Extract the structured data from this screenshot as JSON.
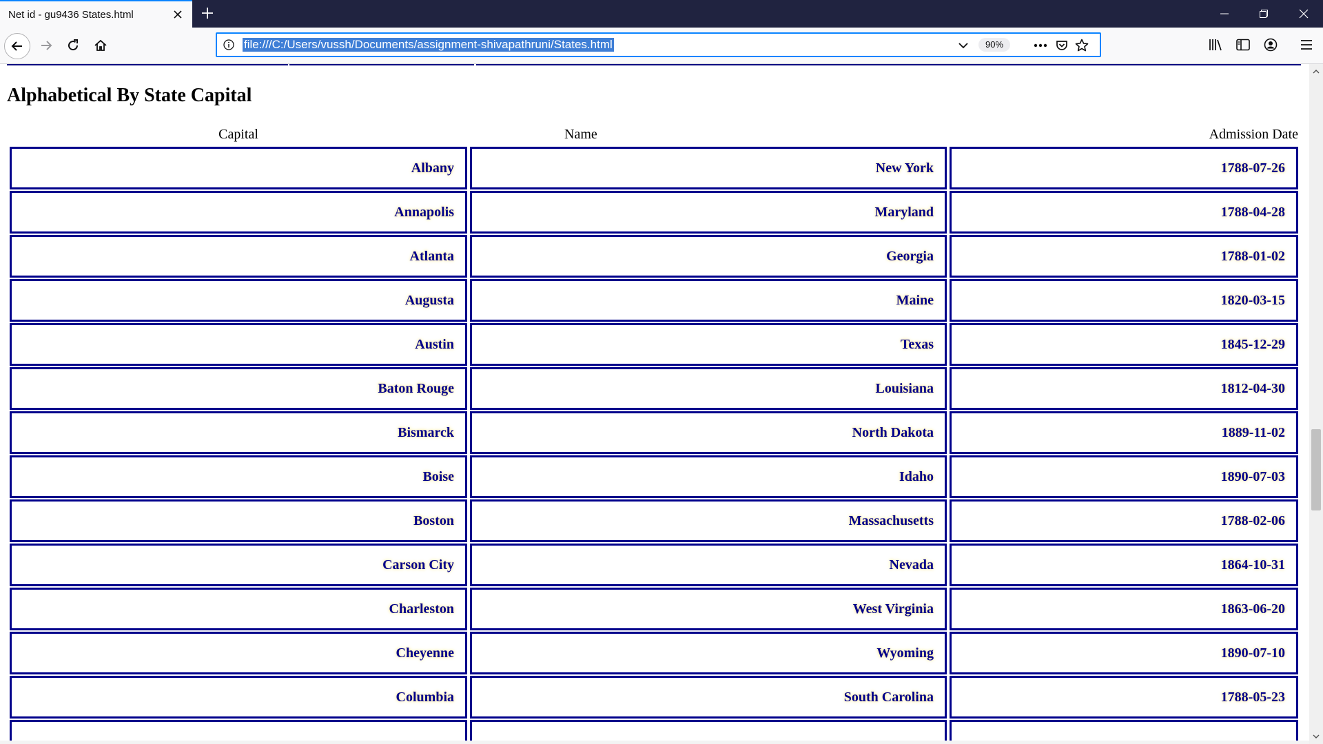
{
  "browser": {
    "tab_title": "Net id - gu9436 States.html",
    "url": "file:///C:/Users/vussh/Documents/assignment-shivapathruni/States.html",
    "zoom": "90%",
    "accent_color": "#0a84ff",
    "titlebar_color": "#202340"
  },
  "page": {
    "section_title": "Alphabetical By State Capital",
    "columns": {
      "capital": "Capital",
      "name": "Name",
      "admission_date": "Admission Date"
    },
    "rows": [
      {
        "capital": "Albany",
        "name": "New York",
        "date": "1788-07-26"
      },
      {
        "capital": "Annapolis",
        "name": "Maryland",
        "date": "1788-04-28"
      },
      {
        "capital": "Atlanta",
        "name": "Georgia",
        "date": "1788-01-02"
      },
      {
        "capital": "Augusta",
        "name": "Maine",
        "date": "1820-03-15"
      },
      {
        "capital": "Austin",
        "name": "Texas",
        "date": "1845-12-29"
      },
      {
        "capital": "Baton Rouge",
        "name": "Louisiana",
        "date": "1812-04-30"
      },
      {
        "capital": "Bismarck",
        "name": "North Dakota",
        "date": "1889-11-02"
      },
      {
        "capital": "Boise",
        "name": "Idaho",
        "date": "1890-07-03"
      },
      {
        "capital": "Boston",
        "name": "Massachusetts",
        "date": "1788-02-06"
      },
      {
        "capital": "Carson City",
        "name": "Nevada",
        "date": "1864-10-31"
      },
      {
        "capital": "Charleston",
        "name": "West Virginia",
        "date": "1863-06-20"
      },
      {
        "capital": "Cheyenne",
        "name": "Wyoming",
        "date": "1890-07-10"
      },
      {
        "capital": "Columbia",
        "name": "South Carolina",
        "date": "1788-05-23"
      }
    ],
    "cell_text_color": "#00008b",
    "cell_border_color": "#00008b"
  },
  "icons": {
    "tab_close": "close-icon",
    "new_tab": "plus-icon",
    "minimize": "minimize-icon",
    "restore": "restore-icon",
    "close_window": "close-window-icon",
    "back": "back-arrow-icon",
    "forward": "forward-arrow-icon",
    "reload": "reload-icon",
    "home": "home-icon",
    "site_info": "info-icon",
    "url_dropdown": "chevron-down-icon",
    "page_actions": "more-icon",
    "pocket": "pocket-icon",
    "bookmark": "star-icon",
    "library": "library-icon",
    "sidebar": "sidebar-icon",
    "account": "account-icon",
    "menu": "hamburger-icon"
  }
}
